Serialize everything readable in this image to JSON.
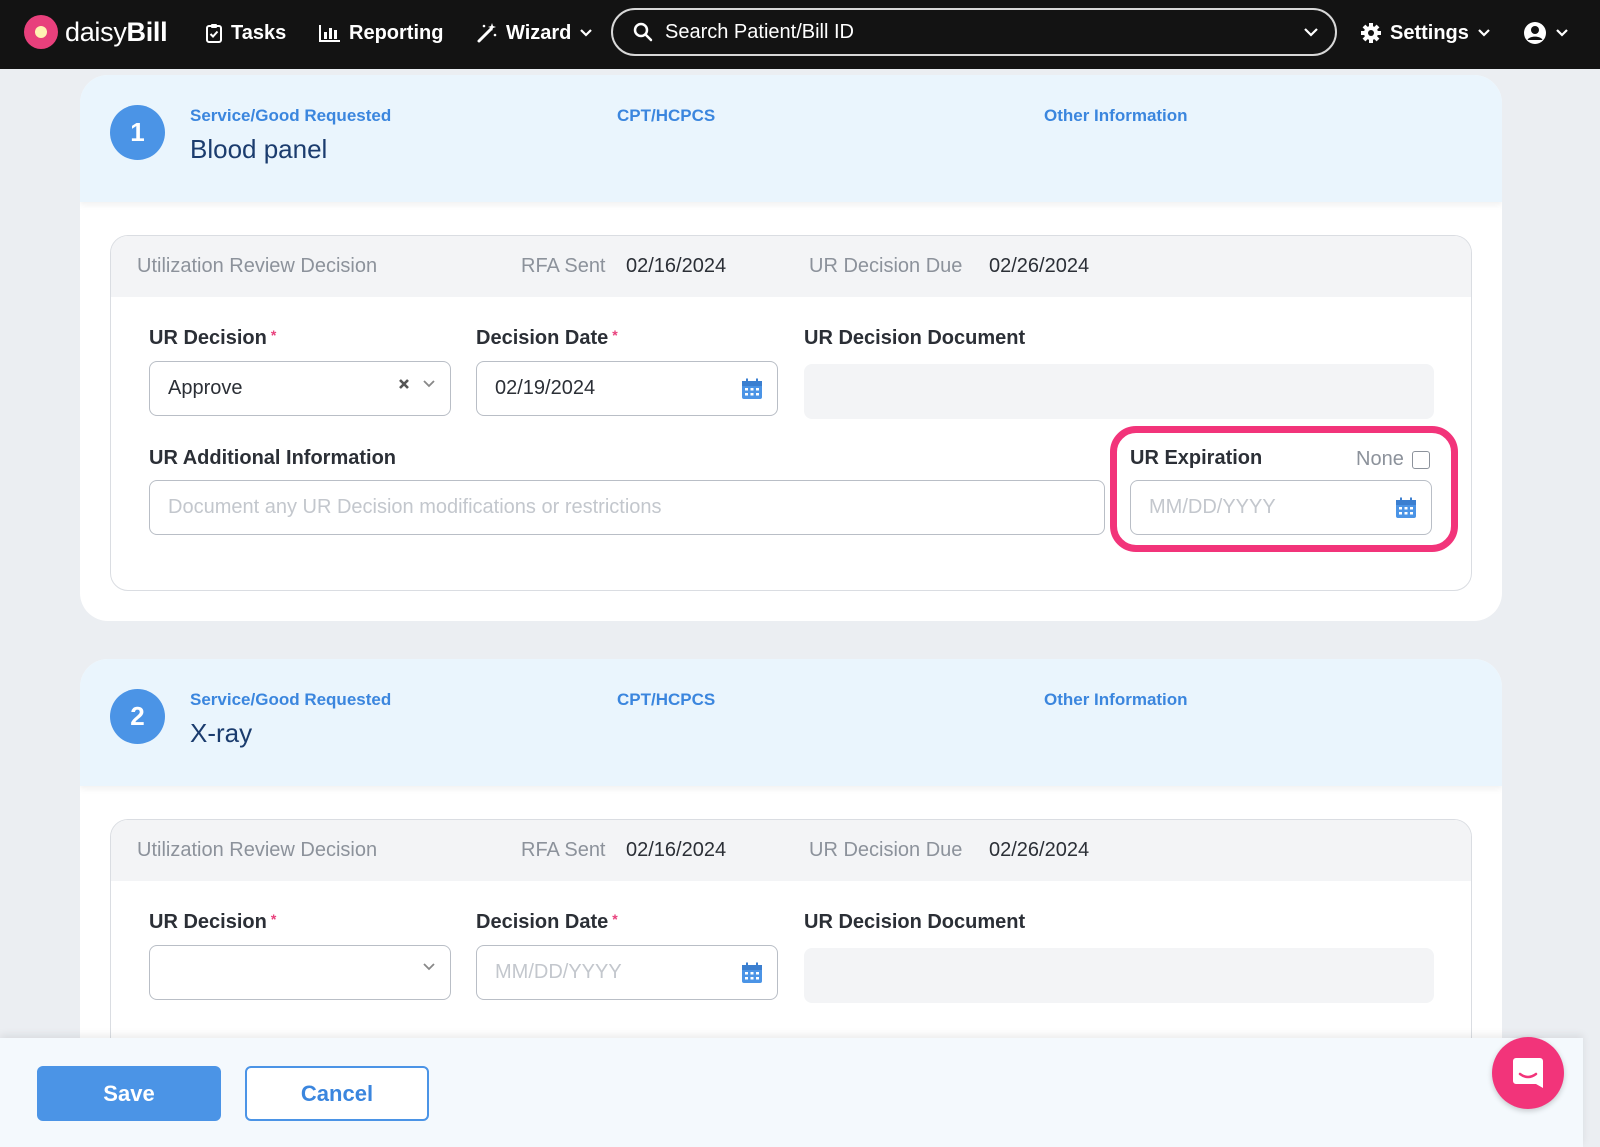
{
  "nav": {
    "brand_light": "daisy",
    "brand_bold": "Bill",
    "tasks": "Tasks",
    "reporting": "Reporting",
    "wizard": "Wizard",
    "search_placeholder": "Search Patient/Bill ID",
    "settings": "Settings"
  },
  "cards": [
    {
      "number": "1",
      "service_label": "Service/Good Requested",
      "service_value": "Blood panel",
      "cpt_label": "CPT/HCPCS",
      "other_label": "Other Information",
      "ur_title": "Utilization Review Decision",
      "rfa_label": "RFA Sent",
      "rfa_value": "02/16/2024",
      "due_label": "UR Decision Due",
      "due_value": "02/26/2024",
      "decision_label": "UR Decision",
      "decision_value": "Approve",
      "date_label": "Decision Date",
      "date_value": "02/19/2024",
      "document_label": "UR Decision Document",
      "additional_label": "UR Additional Information",
      "additional_placeholder": "Document any UR Decision modifications or restrictions",
      "expiration_label": "UR Expiration",
      "none_label": "None",
      "expiration_placeholder": "MM/DD/YYYY"
    },
    {
      "number": "2",
      "service_label": "Service/Good Requested",
      "service_value": "X-ray",
      "cpt_label": "CPT/HCPCS",
      "other_label": "Other Information",
      "ur_title": "Utilization Review Decision",
      "rfa_label": "RFA Sent",
      "rfa_value": "02/16/2024",
      "due_label": "UR Decision Due",
      "due_value": "02/26/2024",
      "decision_label": "UR Decision",
      "decision_value": "",
      "date_label": "Decision Date",
      "date_placeholder": "MM/DD/YYYY",
      "document_label": "UR Decision Document"
    }
  ],
  "footer": {
    "save": "Save",
    "cancel": "Cancel"
  },
  "colors": {
    "accent": "#4b94e6",
    "highlight": "#f2347a",
    "navbar": "#131313"
  }
}
